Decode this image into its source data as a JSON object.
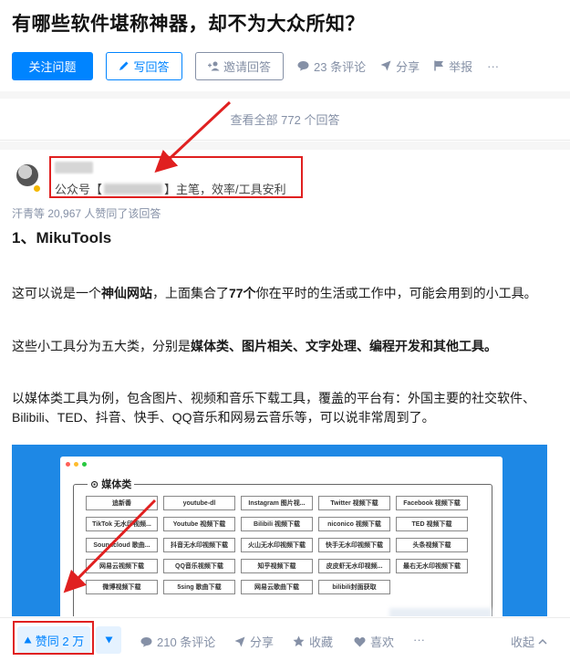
{
  "question": {
    "title": "有哪些软件堪称神器，却不为大众所知？"
  },
  "actions": {
    "follow_label": "关注问题",
    "write_label": "写回答",
    "invite_label": "邀请回答",
    "comments_label": "23 条评论",
    "share_label": "分享",
    "report_label": "举报",
    "more_label": "···"
  },
  "view_all": {
    "label": "查看全部 772 个回答"
  },
  "answer": {
    "author_bio_prefix": "公众号【",
    "author_bio_suffix": "】主笔，效率/工具安利",
    "upvoters": "汗青等 20,967 人赞同了该回答",
    "section_title": "1、MikuTools",
    "para1": {
      "t1": "这可以说是一个",
      "b1": "神仙网站",
      "t2": "，上面集合了",
      "b2": "77个",
      "t3": "你在平时的生活或工作中，可能会用到的小工具。"
    },
    "para2": {
      "t1": "这些小工具分为五大类，分别是",
      "b1": "媒体类、图片相关、文字处理、编程开发和其他工具。"
    },
    "para3": {
      "line1": "以媒体类工具为例，包含图片、视频和音乐下载工具，覆盖的平台有：外国主要的社交软件、",
      "line2": "Bilibili、TED、抖音、快手、QQ音乐和网易云音乐等，可以说非常周到了。"
    },
    "screenshot": {
      "category_label": "⊙ 媒体类",
      "tools": [
        "追新番",
        "youtube-dl",
        "Instagram 图片视...",
        "Twitter 视频下载",
        "Facebook 视频下载",
        "TikTok 无水印视频...",
        "Youtube 视频下载",
        "Bilibili 视频下载",
        "niconico 视频下载",
        "TED 视频下载",
        "Soundcloud 歌曲...",
        "抖音无水印视频下载",
        "火山无水印视频下载",
        "快手无水印视频下载",
        "头条视频下载",
        "网易云视频下载",
        "QQ音乐视频下载",
        "知乎视频下载",
        "皮皮虾无水印视频...",
        "最右无水印视频下载",
        "微博视频下载",
        "5sing 歌曲下载",
        "网易云歌曲下载",
        "bilibili封面获取",
        ""
      ],
      "dot_colors": [
        "#ff5f57",
        "#febc2e",
        "#28c840"
      ]
    }
  },
  "bottom": {
    "vote_label": "赞同 2 万",
    "comments_label": "210 条评论",
    "share_label": "分享",
    "favorite_label": "收藏",
    "like_label": "喜欢",
    "more_label": "···",
    "collapse_label": "收起"
  },
  "colors": {
    "accent": "#0084ff",
    "muted": "#8590a6",
    "annotation_red": "#e02020"
  }
}
